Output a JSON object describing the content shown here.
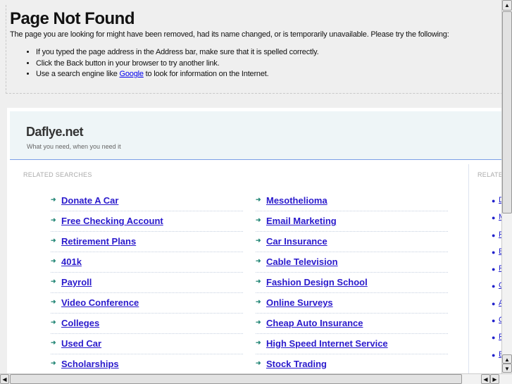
{
  "error": {
    "title": "Page Not Found",
    "message": "The page you are looking for might have been removed, had its name changed, or is temporarily unavailable. Please try the following:",
    "tips": [
      "If you typed the page address in the Address bar, make sure that it is spelled correctly.",
      "Click the Back button in your browser to try another link."
    ],
    "tip3_before": "Use a search engine like ",
    "tip3_link": "Google",
    "tip3_after": " to look for information on the Internet."
  },
  "site": {
    "name": "Daflye.net",
    "tagline": "What you need, when you need it"
  },
  "related_label": "RELATED SEARCHES",
  "related_label_right": "RELATE",
  "left_links": [
    "Donate A Car",
    "Free Checking Account",
    "Retirement Plans",
    "401k",
    "Payroll",
    "Video Conference",
    "Colleges",
    "Used Car",
    "Scholarships"
  ],
  "right_links": [
    "Mesothelioma",
    "Email Marketing",
    "Car Insurance",
    "Cable Television",
    "Fashion Design School",
    "Online Surveys",
    "Cheap Auto Insurance",
    "High Speed Internet Service",
    "Stock Trading"
  ],
  "side_links": [
    "D",
    "M",
    "F",
    "E",
    "F",
    "C",
    "A",
    "C",
    "F",
    "E"
  ],
  "icons": {
    "link_bullet": "arrow-right-icon",
    "scroll_up": "▲",
    "scroll_down": "▼",
    "scroll_left": "◀",
    "scroll_right": "▶"
  },
  "colors": {
    "link": "#2a1acc",
    "bullet": "#2a8a7a",
    "header_bg": "#eef5f7",
    "header_rule": "#7b9ee6"
  }
}
